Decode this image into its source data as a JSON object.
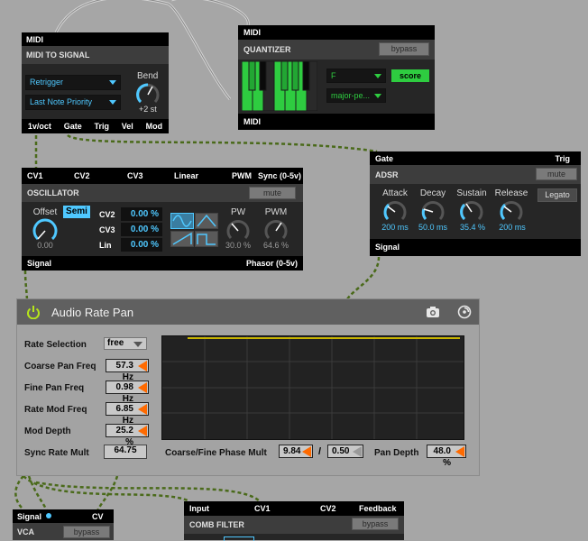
{
  "midi_to_signal": {
    "header": "MIDI",
    "title": "MIDI TO SIGNAL",
    "mode_dropdown": "Retrigger",
    "priority_dropdown": "Last Note Priority",
    "bend_label": "Bend",
    "bend_value": "+2 st",
    "outputs": [
      "1v/oct",
      "Gate",
      "Trig",
      "Vel",
      "Mod"
    ]
  },
  "quantizer": {
    "header_top": "MIDI",
    "title": "QUANTIZER",
    "bypass_label": "bypass",
    "root_dropdown": "F",
    "scale_dropdown": "major-pe...",
    "score_label": "score",
    "header_bottom": "MIDI"
  },
  "oscillator": {
    "inputs": [
      "CV1",
      "CV2",
      "CV3",
      "Linear",
      "PWM",
      "Sync (0-5v)"
    ],
    "title": "OSCILLATOR",
    "mute_label": "mute",
    "offset_label": "Offset",
    "offset_value": "0.00",
    "semi_label": "Semi",
    "cv2_label": "CV2",
    "cv2_value": "0.00 %",
    "cv3_label": "CV3",
    "cv3_value": "0.00 %",
    "lin_label": "Lin",
    "lin_value": "0.00 %",
    "pw_label": "PW",
    "pw_value": "30.0 %",
    "pwm_label": "PWM",
    "pwm_value": "64.6 %",
    "output_left": "Signal",
    "output_right": "Phasor (0-5v)"
  },
  "adsr": {
    "gate_label": "Gate",
    "trig_label": "Trig",
    "title": "ADSR",
    "mute_label": "mute",
    "legato_label": "Legato",
    "knobs": [
      {
        "label": "Attack",
        "value": "200 ms"
      },
      {
        "label": "Decay",
        "value": "50.0 ms"
      },
      {
        "label": "Sustain",
        "value": "35.4 %"
      },
      {
        "label": "Release",
        "value": "200 ms"
      }
    ],
    "output": "Signal"
  },
  "audio_rate_pan": {
    "title": "Audio Rate Pan",
    "rate_selection_label": "Rate Selection",
    "rate_selection_value": "free",
    "coarse_label": "Coarse Pan Freq",
    "coarse_value": "57.3 Hz",
    "fine_label": "Fine Pan Freq",
    "fine_value": "0.98 Hz",
    "ratemod_label": "Rate Mod Freq",
    "ratemod_value": "6.85 Hz",
    "moddepth_label": "Mod Depth",
    "moddepth_value": "25.2 %",
    "syncmult_label": "Sync Rate Mult",
    "syncmult_value": "64.75",
    "phase_mult_label": "Coarse/Fine Phase Mult",
    "phase_mult_value1": "9.84",
    "phase_sep": "/",
    "phase_mult_value2": "0.50",
    "pan_depth_label": "Pan Depth",
    "pan_depth_value": "48.0 %"
  },
  "vca": {
    "signal_label": "Signal",
    "cv_label": "CV",
    "title": "VCA",
    "bypass_label": "bypass"
  },
  "comb_filter": {
    "inputs": [
      "Input",
      "CV1",
      "CV2",
      "Feedback"
    ],
    "title": "COMB FILTER",
    "bypass_label": "bypass"
  },
  "colors": {
    "accent_blue": "#4fc8ff",
    "accent_green": "#2ecc40",
    "accent_orange": "#ff6a00",
    "cable_green": "#5a7a20",
    "cable_grey": "#d0d0d0"
  }
}
